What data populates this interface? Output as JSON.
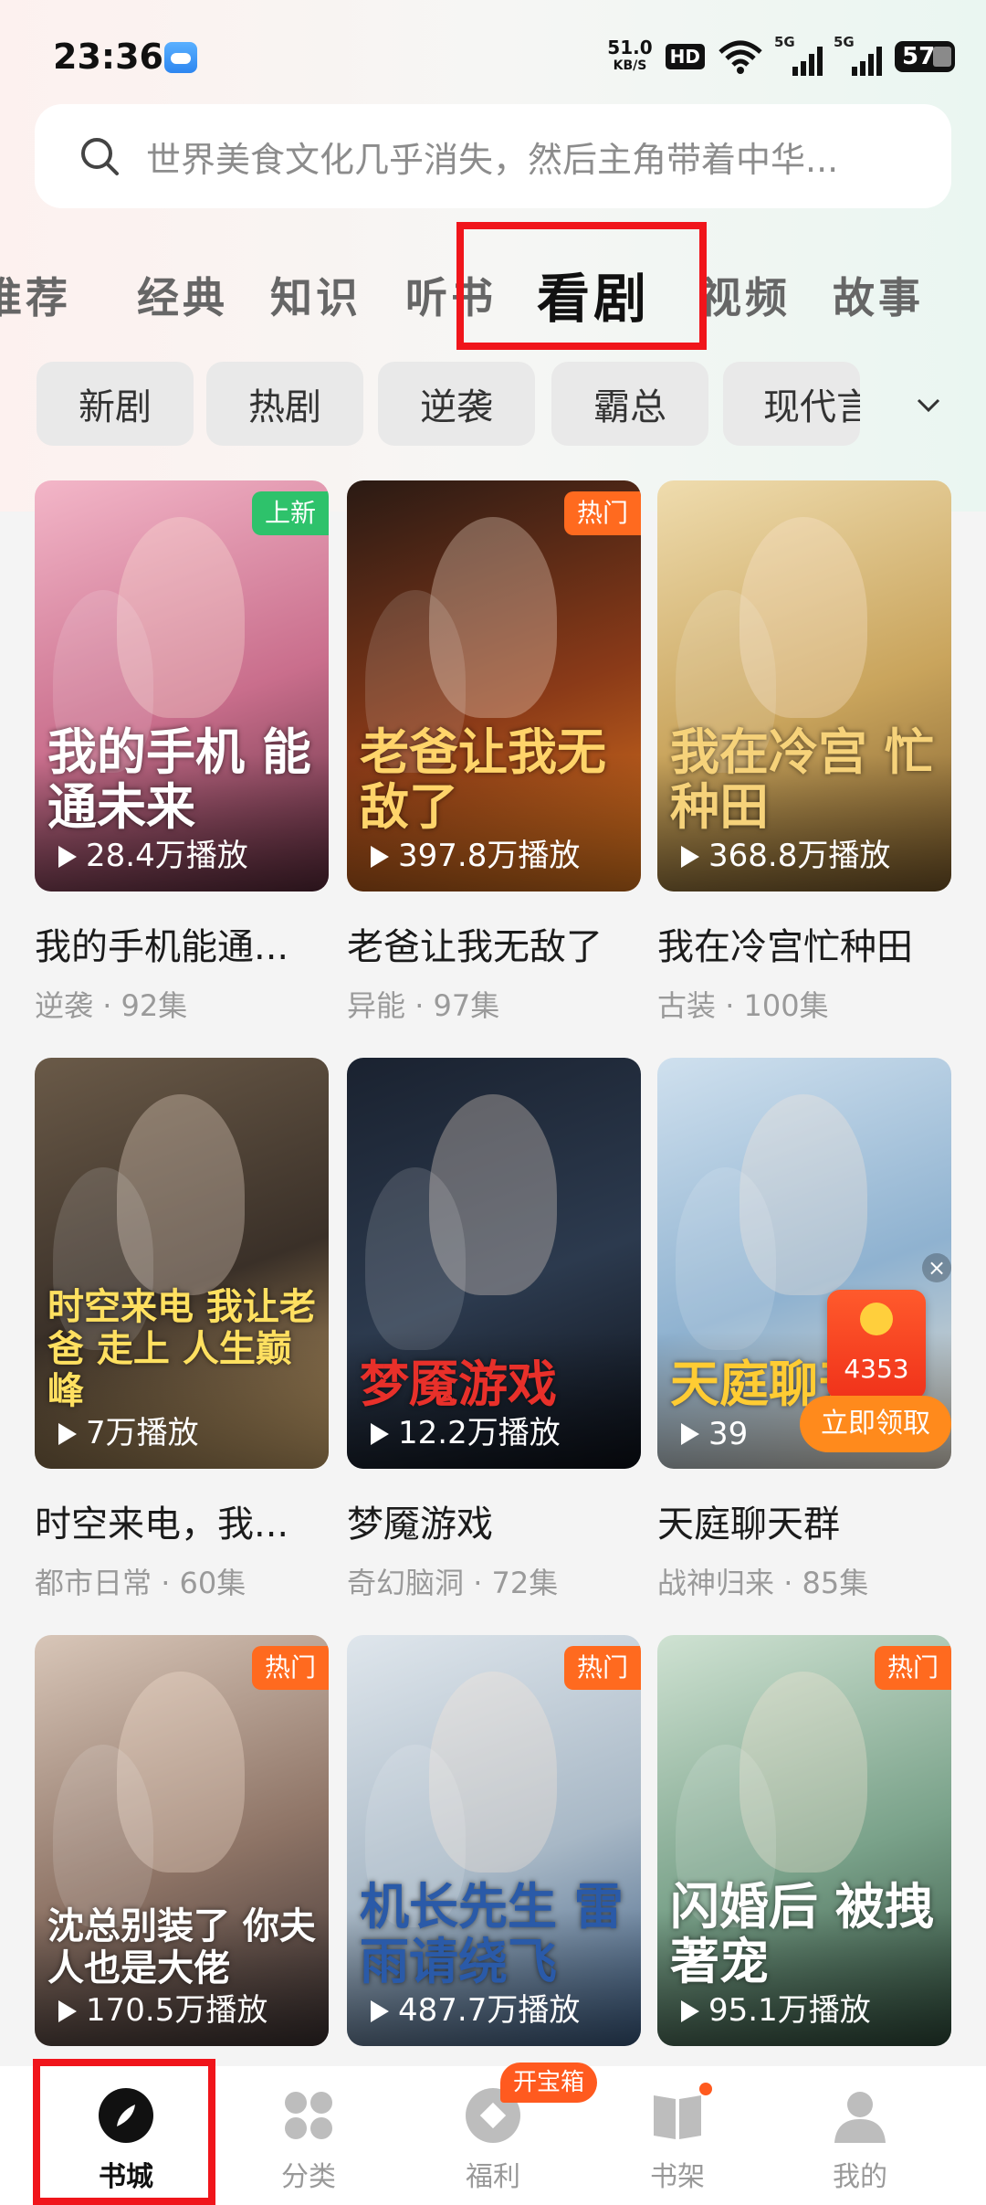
{
  "status_bar": {
    "time": "23:36",
    "net_speed": "51.0",
    "net_unit": "KB/S",
    "hd": "HD",
    "sig1": "5G",
    "sig2": "5G",
    "battery": "57",
    "icons": [
      "weather-icon",
      "wifi-icon",
      "signal-icon",
      "battery-icon"
    ]
  },
  "search": {
    "placeholder": "世界美食文化几乎消失，然后主角带着中华..."
  },
  "top_tabs": [
    "推荐",
    "经典",
    "知识",
    "听书",
    "看剧",
    "视频",
    "故事"
  ],
  "active_tab": "看剧",
  "chips": [
    "新剧",
    "热剧",
    "逆袭",
    "霸总",
    "现代言"
  ],
  "dramas": [
    {
      "title": "我的手机能通...",
      "art": "我的手机 能通未来",
      "genre": "逆袭",
      "episodes": "92集",
      "plays": "28.4万播放",
      "badge": "上新",
      "badge_type": "new",
      "colors": [
        "#f3b6c8",
        "#c96e8c",
        "#5a2a3a"
      ],
      "art_color": "#ffffff"
    },
    {
      "title": "老爸让我无敌了",
      "art": "老爸让我无敌了",
      "genre": "异能",
      "episodes": "97集",
      "plays": "397.8万播放",
      "badge": "热门",
      "badge_type": "hot",
      "colors": [
        "#2a1a14",
        "#8a3a18",
        "#e0781e"
      ],
      "art_color": "#ffd46a"
    },
    {
      "title": "我在冷宫忙种田",
      "art": "我在冷宫 忙种田",
      "genre": "古装",
      "episodes": "100集",
      "plays": "368.8万播放",
      "badge": "",
      "badge_type": "",
      "colors": [
        "#efdcae",
        "#c9a45c",
        "#7a5a2a"
      ],
      "art_color": "#f6d27a"
    },
    {
      "title": "时空来电，我...",
      "art": "时空来电 我让老爸 走上 人生巅峰",
      "genre": "都市日常",
      "episodes": "60集",
      "plays": "7万播放",
      "badge": "",
      "badge_type": "",
      "colors": [
        "#6a5a48",
        "#3a3028",
        "#caa46a"
      ],
      "art_color": "#ffe060"
    },
    {
      "title": "梦魇游戏",
      "art": "梦魇游戏",
      "genre": "奇幻脑洞",
      "episodes": "72集",
      "plays": "12.2万播放",
      "badge": "",
      "badge_type": "",
      "colors": [
        "#1a2230",
        "#2c3a4e",
        "#0c1018"
      ],
      "art_color": "#e8302a"
    },
    {
      "title": "天庭聊天群",
      "art": "天庭聊天群",
      "genre": "战神归来",
      "episodes": "85集",
      "plays": "39",
      "badge": "",
      "badge_type": "",
      "colors": [
        "#cfe0ee",
        "#8fb2d0",
        "#e8e0d0"
      ],
      "art_color": "#ffcc33"
    },
    {
      "title": "",
      "art": "沈总别装了 你夫人也是大佬",
      "genre": "",
      "episodes": "",
      "plays": "170.5万播放",
      "badge": "热门",
      "badge_type": "hot",
      "colors": [
        "#d8c6b8",
        "#8e7466",
        "#3a3030"
      ],
      "art_color": "#ffffff"
    },
    {
      "title": "",
      "art": "机长先生 雷雨请绕飞",
      "genre": "",
      "episodes": "",
      "plays": "487.7万播放",
      "badge": "热门",
      "badge_type": "hot",
      "colors": [
        "#dfe6ec",
        "#a8b8c6",
        "#3a5a80"
      ],
      "art_color": "#2a5aa8"
    },
    {
      "title": "",
      "art": "闪婚后 被拽著宠",
      "genre": "",
      "episodes": "",
      "plays": "95.1万播放",
      "badge": "热门",
      "badge_type": "hot",
      "colors": [
        "#cfe2d2",
        "#7aa28a",
        "#2e4a3a"
      ],
      "art_color": "#ffffff"
    }
  ],
  "red_packet": {
    "value": "4353",
    "claim": "立即领取",
    "close": "×"
  },
  "bottom_nav": [
    {
      "label": "书城",
      "icon": "compass-icon"
    },
    {
      "label": "分类",
      "icon": "category-grid-icon"
    },
    {
      "label": "福利",
      "icon": "coin-icon",
      "badge": "开宝箱"
    },
    {
      "label": "书架",
      "icon": "bookshelf-icon"
    },
    {
      "label": "我的",
      "icon": "profile-icon"
    }
  ],
  "colors": {
    "accent": "#ff6a1f",
    "highlight": "#f0151b",
    "new_badge": "#2ec26b"
  }
}
